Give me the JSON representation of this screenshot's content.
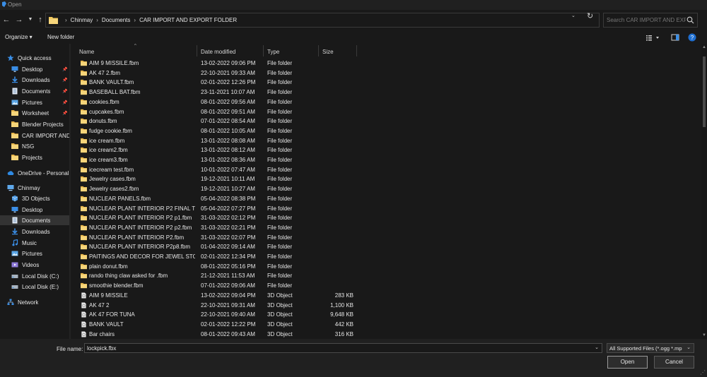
{
  "window": {
    "title": "Open"
  },
  "nav": {
    "back_icon": "back-arrow-icon",
    "forward_icon": "forward-arrow-icon",
    "recent_icon": "chevron-down-icon",
    "up_icon": "up-arrow-icon",
    "breadcrumbs": [
      "Chinmay",
      "Documents",
      "CAR IMPORT AND EXPORT FOLDER"
    ],
    "search_placeholder": "Search CAR IMPORT AND EXP..."
  },
  "toolbar": {
    "organize_label": "Organize ▾",
    "new_folder_label": "New folder"
  },
  "sidebar": {
    "items": [
      {
        "label": "Quick access",
        "icon": "star-icon",
        "pinned": false
      },
      {
        "label": "Desktop",
        "icon": "desktop-icon",
        "pinned": true
      },
      {
        "label": "Downloads",
        "icon": "download-icon",
        "pinned": true
      },
      {
        "label": "Documents",
        "icon": "documents-icon",
        "pinned": true
      },
      {
        "label": "Pictures",
        "icon": "pictures-icon",
        "pinned": true
      },
      {
        "label": "Worksheet",
        "icon": "folder-icon",
        "pinned": true
      },
      {
        "label": "Blender Projects",
        "icon": "folder-icon",
        "pinned": false
      },
      {
        "label": "CAR IMPORT AND E",
        "icon": "folder-icon",
        "pinned": false
      },
      {
        "label": "NSG",
        "icon": "folder-icon",
        "pinned": false
      },
      {
        "label": "Projects",
        "icon": "folder-icon",
        "pinned": false
      },
      {
        "label": "OneDrive - Personal",
        "icon": "cloud-icon",
        "pinned": false
      },
      {
        "label": "Chinmay",
        "icon": "computer-icon",
        "pinned": false
      },
      {
        "label": "3D Objects",
        "icon": "cube-icon",
        "pinned": false
      },
      {
        "label": "Desktop",
        "icon": "desktop-icon",
        "pinned": false
      },
      {
        "label": "Documents",
        "icon": "documents-icon",
        "pinned": false
      },
      {
        "label": "Downloads",
        "icon": "download-icon",
        "pinned": false
      },
      {
        "label": "Music",
        "icon": "music-icon",
        "pinned": false
      },
      {
        "label": "Pictures",
        "icon": "pictures-icon",
        "pinned": false
      },
      {
        "label": "Videos",
        "icon": "videos-icon",
        "pinned": false
      },
      {
        "label": "Local Disk (C:)",
        "icon": "drive-icon",
        "pinned": false
      },
      {
        "label": "Local Disk (E:)",
        "icon": "drive-icon",
        "pinned": false
      },
      {
        "label": "Network",
        "icon": "network-icon",
        "pinned": false
      }
    ],
    "selected_label": "Documents"
  },
  "columns": {
    "name": "Name",
    "date": "Date modified",
    "type": "Type",
    "size": "Size"
  },
  "files": [
    {
      "name": "AIM 9 MISSILE.fbm",
      "date": "13-02-2022 09:06 PM",
      "type": "File folder",
      "size": "",
      "kind": "folder"
    },
    {
      "name": "AK 47 2.fbm",
      "date": "22-10-2021 09:33 AM",
      "type": "File folder",
      "size": "",
      "kind": "folder"
    },
    {
      "name": "BANK VAULT.fbm",
      "date": "02-01-2022 12:26 PM",
      "type": "File folder",
      "size": "",
      "kind": "folder"
    },
    {
      "name": "BASEBALL BAT.fbm",
      "date": "23-11-2021 10:07 AM",
      "type": "File folder",
      "size": "",
      "kind": "folder"
    },
    {
      "name": "cookies.fbm",
      "date": "08-01-2022 09:56 AM",
      "type": "File folder",
      "size": "",
      "kind": "folder"
    },
    {
      "name": "cupcakes.fbm",
      "date": "08-01-2022 09:51 AM",
      "type": "File folder",
      "size": "",
      "kind": "folder"
    },
    {
      "name": "donuts.fbm",
      "date": "07-01-2022 08:54 AM",
      "type": "File folder",
      "size": "",
      "kind": "folder"
    },
    {
      "name": "fudge cookie.fbm",
      "date": "08-01-2022 10:05 AM",
      "type": "File folder",
      "size": "",
      "kind": "folder"
    },
    {
      "name": "ice cream.fbm",
      "date": "13-01-2022 08:08 AM",
      "type": "File folder",
      "size": "",
      "kind": "folder"
    },
    {
      "name": "ice cream2.fbm",
      "date": "13-01-2022 08:12 AM",
      "type": "File folder",
      "size": "",
      "kind": "folder"
    },
    {
      "name": "ice cream3.fbm",
      "date": "13-01-2022 08:36 AM",
      "type": "File folder",
      "size": "",
      "kind": "folder"
    },
    {
      "name": "icecream test.fbm",
      "date": "10-01-2022 07:47 AM",
      "type": "File folder",
      "size": "",
      "kind": "folder"
    },
    {
      "name": "Jewelry cases.fbm",
      "date": "19-12-2021 10:11 AM",
      "type": "File folder",
      "size": "",
      "kind": "folder"
    },
    {
      "name": "Jewelry cases2.fbm",
      "date": "19-12-2021 10:27 AM",
      "type": "File folder",
      "size": "",
      "kind": "folder"
    },
    {
      "name": "NUCLEAR PANELS.fbm",
      "date": "05-04-2022 08:38 PM",
      "type": "File folder",
      "size": "",
      "kind": "folder"
    },
    {
      "name": "NUCLEAR PLANT INTERIOR P2 FINAL TR...",
      "date": "05-04-2022 07:27 PM",
      "type": "File folder",
      "size": "",
      "kind": "folder"
    },
    {
      "name": "NUCLEAR PLANT INTERIOR P2 p1.fbm",
      "date": "31-03-2022 02:12 PM",
      "type": "File folder",
      "size": "",
      "kind": "folder"
    },
    {
      "name": "NUCLEAR PLANT INTERIOR P2 p2.fbm",
      "date": "31-03-2022 02:21 PM",
      "type": "File folder",
      "size": "",
      "kind": "folder"
    },
    {
      "name": "NUCLEAR PLANT INTERIOR P2.fbm",
      "date": "31-03-2022 02:07 PM",
      "type": "File folder",
      "size": "",
      "kind": "folder"
    },
    {
      "name": "NUCLEAR PLANT INTERIOR P2p8.fbm",
      "date": "01-04-2022 09:14 AM",
      "type": "File folder",
      "size": "",
      "kind": "folder"
    },
    {
      "name": "PAITINGS AND DECOR FOR JEWEL STORE...",
      "date": "02-01-2022 12:34 PM",
      "type": "File folder",
      "size": "",
      "kind": "folder"
    },
    {
      "name": "plain donut.fbm",
      "date": "08-01-2022 05:16 PM",
      "type": "File folder",
      "size": "",
      "kind": "folder"
    },
    {
      "name": "rando thing claw asked for .fbm",
      "date": "21-12-2021 11:53 AM",
      "type": "File folder",
      "size": "",
      "kind": "folder"
    },
    {
      "name": "smoothie blender.fbm",
      "date": "07-01-2022 09:06 AM",
      "type": "File folder",
      "size": "",
      "kind": "folder"
    },
    {
      "name": "AIM 9 MISSILE",
      "date": "13-02-2022 09:04 PM",
      "type": "3D Object",
      "size": "283 KB",
      "kind": "object"
    },
    {
      "name": "AK 47 2",
      "date": "22-10-2021 09:31 AM",
      "type": "3D Object",
      "size": "1,100 KB",
      "kind": "object"
    },
    {
      "name": "AK 47 FOR TUNA",
      "date": "22-10-2021 09:40 AM",
      "type": "3D Object",
      "size": "9,648 KB",
      "kind": "object"
    },
    {
      "name": "BANK VAULT",
      "date": "02-01-2022 12:22 PM",
      "type": "3D Object",
      "size": "442 KB",
      "kind": "object"
    },
    {
      "name": "Bar chairs",
      "date": "08-01-2022 09:43 AM",
      "type": "3D Object",
      "size": "316 KB",
      "kind": "object"
    }
  ],
  "bottom": {
    "file_name_label": "File name:",
    "file_name_value": "lockpick.fbx",
    "file_type_value": "All Supported Files (*.ogg *.mp",
    "open_label": "Open",
    "cancel_label": "Cancel"
  },
  "colors": {
    "background": "#191919",
    "folder": "#f0c75a",
    "accent": "#3a8ee6"
  }
}
